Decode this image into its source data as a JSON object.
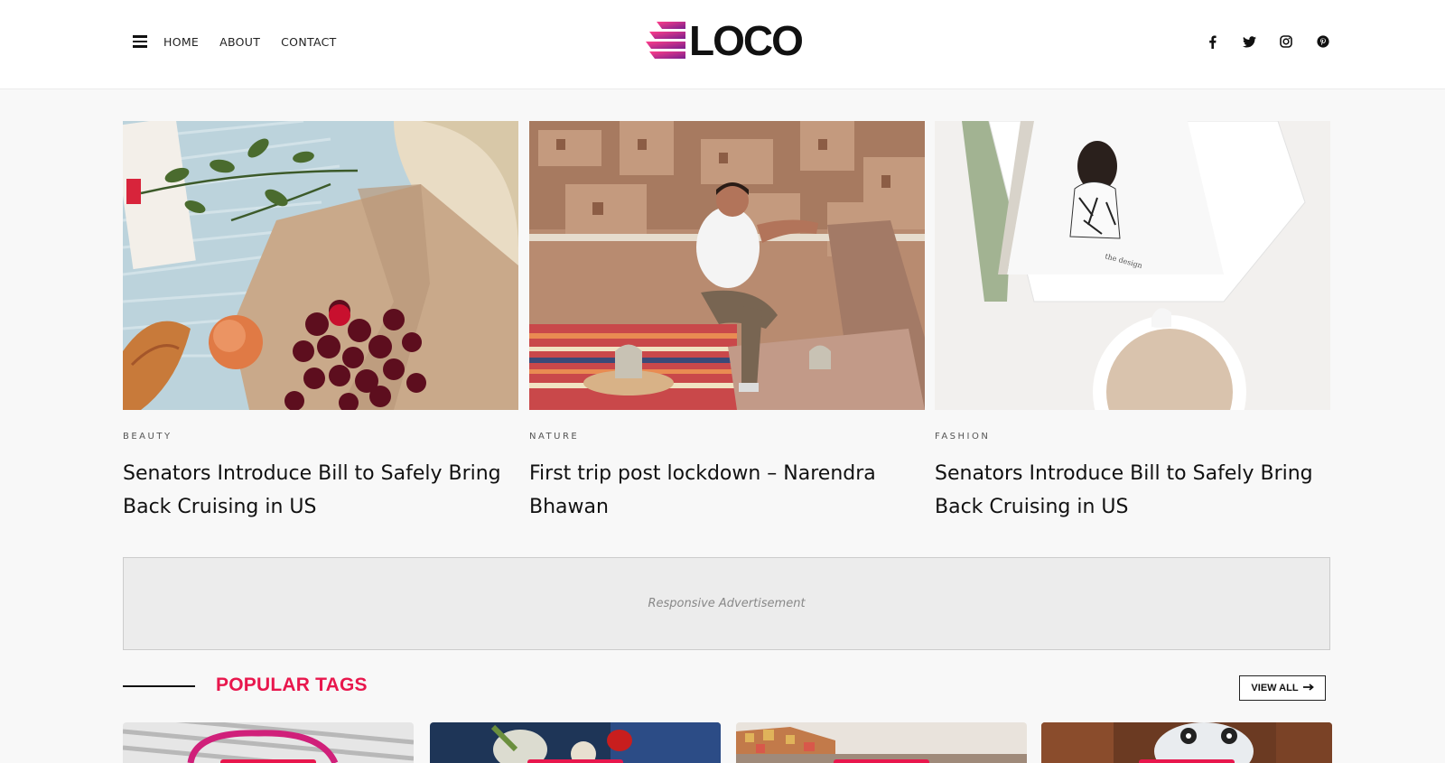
{
  "header": {
    "nav": [
      {
        "label": "HOME"
      },
      {
        "label": "ABOUT"
      },
      {
        "label": "CONTACT"
      }
    ],
    "logo_text": "LOCO",
    "social_icons": [
      "facebook-icon",
      "twitter-icon",
      "instagram-icon",
      "pinterest-icon"
    ],
    "brand_color": "#e8174d"
  },
  "featured": [
    {
      "category": "BEAUTY",
      "title": "Senators Introduce Bill to Safely Bring Back Cruising in US",
      "image": "cherries-picnic-photo"
    },
    {
      "category": "NATURE",
      "title": "First trip post lockdown – Narendra Bhawan",
      "image": "man-on-rooftop-photo"
    },
    {
      "category": "FASHION",
      "title": "Senators Introduce Bill to Safely Bring Back Cruising in US",
      "image": "magazine-coffee-photo"
    }
  ],
  "ad": {
    "text": "Responsive Advertisement"
  },
  "popular_tags": {
    "title": "POPULAR TAGS",
    "view_all": "VIEW ALL",
    "cards": [
      "handbag-photo",
      "vegetables-photo",
      "coastal-town-photo",
      "robot-toy-photo"
    ]
  }
}
